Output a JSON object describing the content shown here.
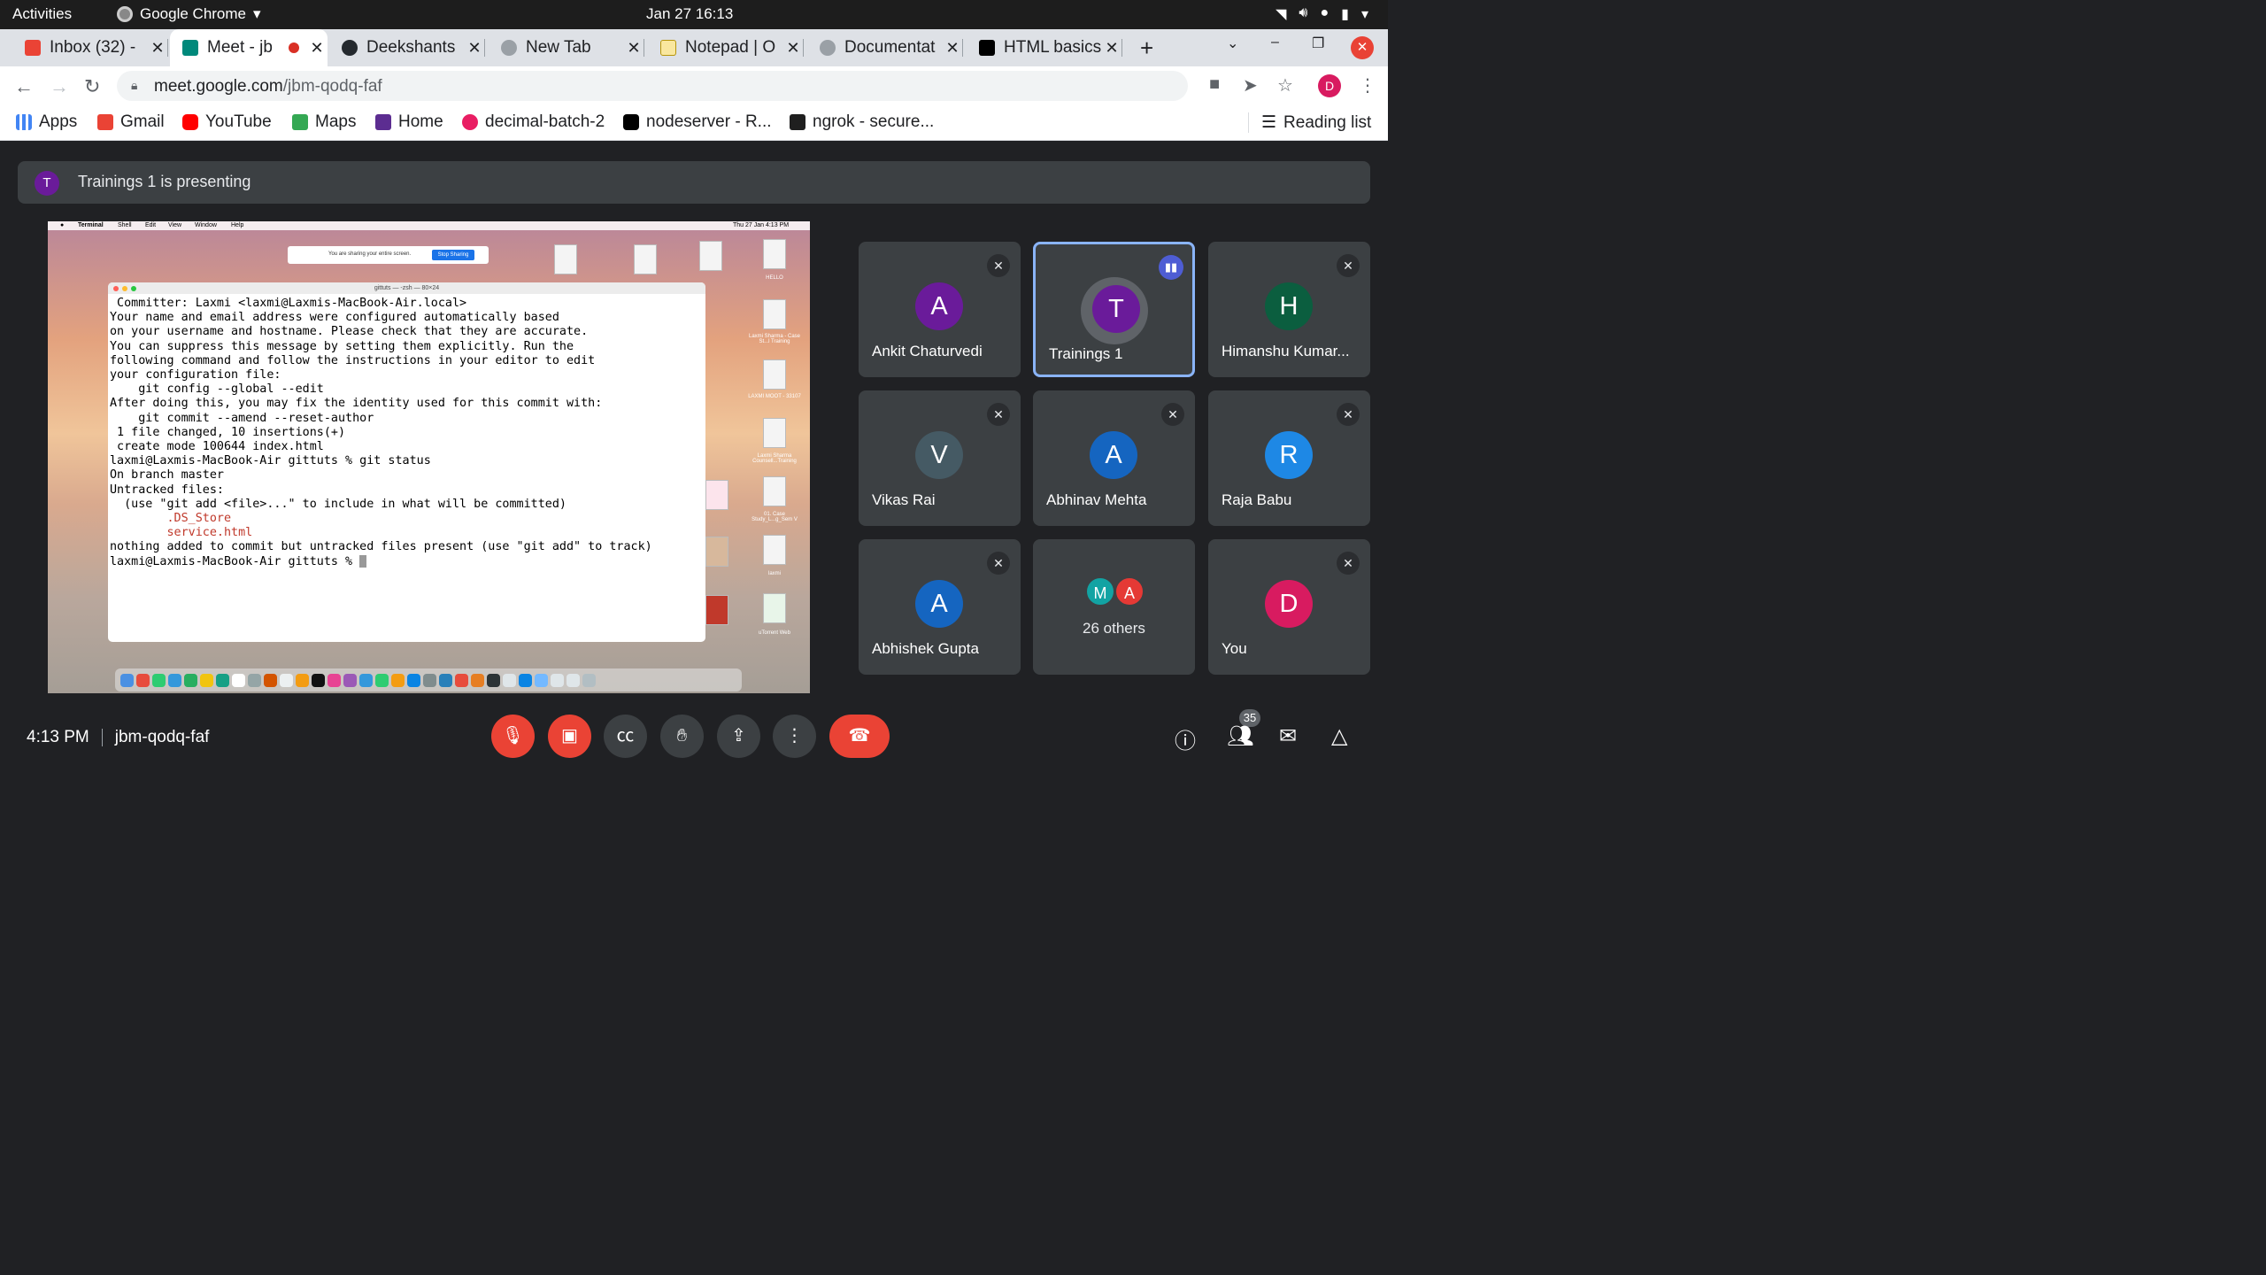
{
  "os_bar": {
    "activities": "Activities",
    "app_name": "Google Chrome",
    "datetime": "Jan 27  16:13"
  },
  "tabs": [
    {
      "title": "Inbox (32) - ",
      "favicon_color": "#ea4335"
    },
    {
      "title": "Meet - jb",
      "favicon_color": "#00897b"
    },
    {
      "title": "Deekshants",
      "favicon_color": "#24292e"
    },
    {
      "title": "New Tab",
      "favicon_color": "#5f6368"
    },
    {
      "title": "Notepad | O",
      "favicon_color": "#f9e79f"
    },
    {
      "title": "Documentat",
      "favicon_color": "#5f6368"
    },
    {
      "title": "HTML basics",
      "favicon_color": "#000000"
    }
  ],
  "tab_close": "✕",
  "address": {
    "host": "meet.google.com",
    "path": "/jbm-qodq-faf"
  },
  "bookmarks": {
    "items": [
      {
        "label": "Apps",
        "color": "#4285f4"
      },
      {
        "label": "Gmail",
        "color": "#ea4335"
      },
      {
        "label": "YouTube",
        "color": "#ff0000"
      },
      {
        "label": "Maps",
        "color": "#34a853"
      },
      {
        "label": "Home",
        "color": "#5c2d91"
      },
      {
        "label": "decimal-batch-2",
        "color": "#e91e63"
      },
      {
        "label": "nodeserver - R...",
        "color": "#000000"
      },
      {
        "label": "ngrok - secure...",
        "color": "#1f1f1f"
      }
    ],
    "reading_list": "Reading list"
  },
  "profile_initial": "D",
  "meet": {
    "presenting_initial": "T",
    "presenting_text": "Trainings 1 is presenting",
    "time": "4:13 PM",
    "code": "jbm-qodq-faf",
    "participant_count": "35"
  },
  "shared_screen": {
    "mac_menu": [
      "Terminal",
      "Shell",
      "Edit",
      "View",
      "Window",
      "Help"
    ],
    "mac_clock": "Thu 27 Jan  4:13 PM",
    "share_notice": "You are sharing your entire screen.",
    "stop_sharing": "Stop Sharing",
    "terminal_title": "gittuts — -zsh — 80×24",
    "desktop_labels": [
      "HELLO",
      "Laxmi Sharma - Case St...l Training",
      "LAXMI MOOT - 33107",
      "Laxmi Sharma Counsell...Training",
      "01. Case Study_L...g_Sem V",
      "laxmi",
      "uTorrent Web"
    ],
    "terminal_lines": [
      " Committer: Laxmi <laxmi@Laxmis-MacBook-Air.local>",
      "Your name and email address were configured automatically based",
      "on your username and hostname. Please check that they are accurate.",
      "You can suppress this message by setting them explicitly. Run the",
      "following command and follow the instructions in your editor to edit",
      "your configuration file:",
      "",
      "    git config --global --edit",
      "",
      "After doing this, you may fix the identity used for this commit with:",
      "",
      "    git commit --amend --reset-author",
      "",
      " 1 file changed, 10 insertions(+)",
      " create mode 100644 index.html",
      "laxmi@Laxmis-MacBook-Air gittuts % git status",
      "On branch master",
      "Untracked files:",
      "  (use \"git add <file>...\" to include in what will be committed)",
      "        .DS_Store",
      "        service.html",
      "",
      "nothing added to commit but untracked files present (use \"git add\" to track)",
      "laxmi@Laxmis-MacBook-Air gittuts % "
    ]
  },
  "participants": [
    {
      "initial": "A",
      "name": "Ankit Chaturvedi",
      "color": "#6a1b9a"
    },
    {
      "initial": "T",
      "name": "Trainings 1",
      "color": "#6a1b9a"
    },
    {
      "initial": "H",
      "name": "Himanshu Kumar...",
      "color": "#0b5e3f"
    },
    {
      "initial": "V",
      "name": "Vikas Rai",
      "color": "#455a64"
    },
    {
      "initial": "A",
      "name": "Abhinav Mehta",
      "color": "#1565c0"
    },
    {
      "initial": "R",
      "name": "Raja Babu",
      "color": "#1e88e5"
    },
    {
      "initial": "A",
      "name": "Abhishek Gupta",
      "color": "#1565c0"
    },
    {
      "initial": "D",
      "name": "You",
      "color": "#d81b60"
    }
  ],
  "others": {
    "label": "26 others",
    "initials": [
      "M",
      "A"
    ],
    "colors": [
      "#12a3a3",
      "#e53935"
    ]
  }
}
